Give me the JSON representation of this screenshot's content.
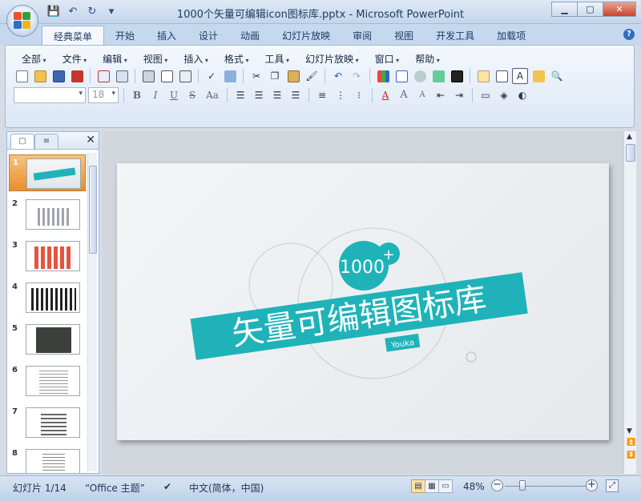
{
  "window": {
    "title": "1000个矢量可编辑icon图标库.pptx - Microsoft PowerPoint",
    "controls": [
      "minimize",
      "maximize",
      "close"
    ]
  },
  "quick_access": [
    "save-icon",
    "undo-icon",
    "redo-icon",
    "customize-icon"
  ],
  "ribbon_tabs": [
    {
      "label": "经典菜单",
      "active": true
    },
    {
      "label": "开始",
      "active": false
    },
    {
      "label": "插入",
      "active": false
    },
    {
      "label": "设计",
      "active": false
    },
    {
      "label": "动画",
      "active": false
    },
    {
      "label": "幻灯片放映",
      "active": false
    },
    {
      "label": "审阅",
      "active": false
    },
    {
      "label": "视图",
      "active": false
    },
    {
      "label": "开发工具",
      "active": false
    },
    {
      "label": "加载项",
      "active": false
    }
  ],
  "menubar": [
    "全部",
    "文件",
    "编辑",
    "视图",
    "插入",
    "格式",
    "工具",
    "幻灯片放映",
    "窗口",
    "帮助"
  ],
  "font_combo": {
    "font_name": "",
    "font_size": "18"
  },
  "format_buttons": {
    "bold": "B",
    "italic": "I",
    "underline": "U",
    "strike": "S",
    "case": "Aa",
    "font_color": "A",
    "grow": "A",
    "shrink": "A"
  },
  "thumbnails": [
    {
      "num": "1",
      "selected": true
    },
    {
      "num": "2",
      "selected": false
    },
    {
      "num": "3",
      "selected": false
    },
    {
      "num": "4",
      "selected": false
    },
    {
      "num": "5",
      "selected": false
    },
    {
      "num": "6",
      "selected": false
    },
    {
      "num": "7",
      "selected": false
    },
    {
      "num": "8",
      "selected": false
    }
  ],
  "slide": {
    "badge_number": "1000",
    "badge_plus": "+",
    "banner_text": "矢量可编辑图标库",
    "author": "Youka",
    "accent_color": "#1fb3b9"
  },
  "status": {
    "slide_counter": "幻灯片 1/14",
    "theme": "“Office 主题”",
    "language": "中文(简体，中国)",
    "zoom": "48%",
    "zoom_minus": "−",
    "zoom_plus": "+"
  }
}
